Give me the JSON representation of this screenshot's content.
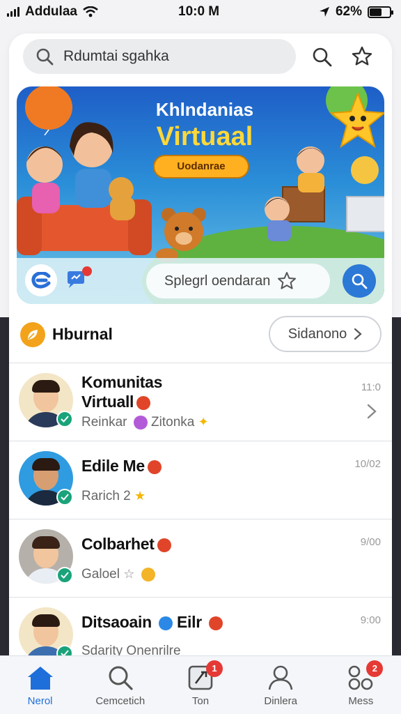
{
  "status_bar": {
    "carrier": "Addulaa",
    "time": "10:0 M",
    "battery": "62%",
    "battery_level": 0.62
  },
  "search": {
    "placeholder": "Rdumtai sgahka"
  },
  "banner": {
    "title_line1": "Khlndanias",
    "title_line2": "Virtuaal",
    "button_label": "Uodanrae",
    "input_text": "Splegrl oendaran"
  },
  "section": {
    "title": "Hburnal",
    "button_label": "Sidanono"
  },
  "list": [
    {
      "name_line1": "Komunitas",
      "name_line2": "Virtuall",
      "subtitle": "Reinkar",
      "subtitle2": "Zitonka",
      "time": "11:0",
      "avatar_bg": "#f3e6c6",
      "body_color": "#2a3a5a"
    },
    {
      "name_line1": "Edile Me",
      "name_line2": "",
      "subtitle": "Rarich 2",
      "subtitle2": "",
      "time": "10/02",
      "avatar_bg": "#2f9be0",
      "body_color": "#1b2a3e"
    },
    {
      "name_line1": "Colbarhet",
      "name_line2": "",
      "subtitle": "Galoel",
      "subtitle2": "",
      "time": "9/00",
      "avatar_bg": "#b5b0aa",
      "body_color": "#e9eef4"
    },
    {
      "name_line1": "Ditsaoain",
      "name_line2": "Eilr",
      "subtitle": "Sdarity Onenrilre",
      "subtitle2": "",
      "time": "9:00",
      "avatar_bg": "#f3e6c6",
      "body_color": "#3c6fb0"
    }
  ],
  "bottom_nav": [
    {
      "label": "Nerol",
      "icon": "home-icon",
      "badge": ""
    },
    {
      "label": "Cemcetich",
      "icon": "search-icon",
      "badge": ""
    },
    {
      "label": "Ton",
      "icon": "compose-icon",
      "badge": "1"
    },
    {
      "label": "Dinlera",
      "icon": "profile-icon",
      "badge": ""
    },
    {
      "label": "Mess",
      "icon": "grid-icon",
      "badge": "2"
    }
  ],
  "colors": {
    "accent": "#1e6fd9",
    "badge": "#e53935",
    "online": "#1aa37a"
  }
}
